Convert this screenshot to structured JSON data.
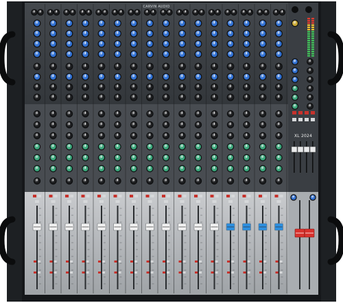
{
  "product": {
    "brand": "CARVIN AUDIO",
    "model": "XL 2024"
  },
  "layout": {
    "channel_count": 16
  },
  "fader_caps": [
    "white",
    "white",
    "white",
    "white",
    "white",
    "white",
    "white",
    "white",
    "white",
    "white",
    "white",
    "white",
    "blue",
    "blue",
    "blue",
    "blue"
  ],
  "colors": {
    "rack_black": "#15171a",
    "top_panel": "#3b3f44",
    "mid_panel": "#4a4e53",
    "fader_panel": "#b9bcbf",
    "knob_blue": "#2f6fd1",
    "knob_green": "#3aa57a",
    "knob_black": "#1c1d1f",
    "cap_white": "#f2f2f2",
    "cap_blue": "#2c8fe0",
    "cap_red": "#d8312d",
    "button_red": "#c7322c",
    "button_gray": "#d6d8da"
  },
  "icons": {
    "rack_handle": "rack-handle-icon",
    "knob": "knob-icon",
    "fader": "fader-icon",
    "meter": "led-meter-icon"
  }
}
